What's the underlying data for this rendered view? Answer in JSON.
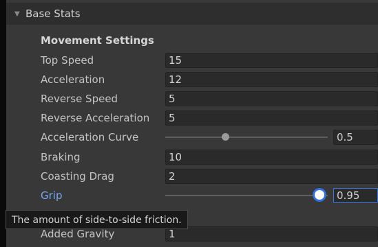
{
  "foldout": {
    "title": "Base Stats"
  },
  "section": {
    "title": "Movement Settings"
  },
  "fields": {
    "top_speed": {
      "label": "Top Speed",
      "value": "15"
    },
    "acceleration": {
      "label": "Acceleration",
      "value": "12"
    },
    "reverse_speed": {
      "label": "Reverse Speed",
      "value": "5"
    },
    "reverse_acceleration": {
      "label": "Reverse Acceleration",
      "value": "5"
    },
    "acceleration_curve": {
      "label": "Acceleration Curve",
      "value": "0.5",
      "slider_fraction": 0.37
    },
    "braking": {
      "label": "Braking",
      "value": "10"
    },
    "coasting_drag": {
      "label": "Coasting Drag",
      "value": "2"
    },
    "grip": {
      "label": "Grip",
      "value": "0.95",
      "slider_fraction": 0.95
    },
    "added_gravity": {
      "label": "Added Gravity",
      "value": "1"
    }
  },
  "tooltip": {
    "text": "The amount of side-to-side friction."
  },
  "colors": {
    "panel_bg": "#383838",
    "focus_label": "#7aa8f0",
    "slider_active": "#2f6fe0"
  }
}
